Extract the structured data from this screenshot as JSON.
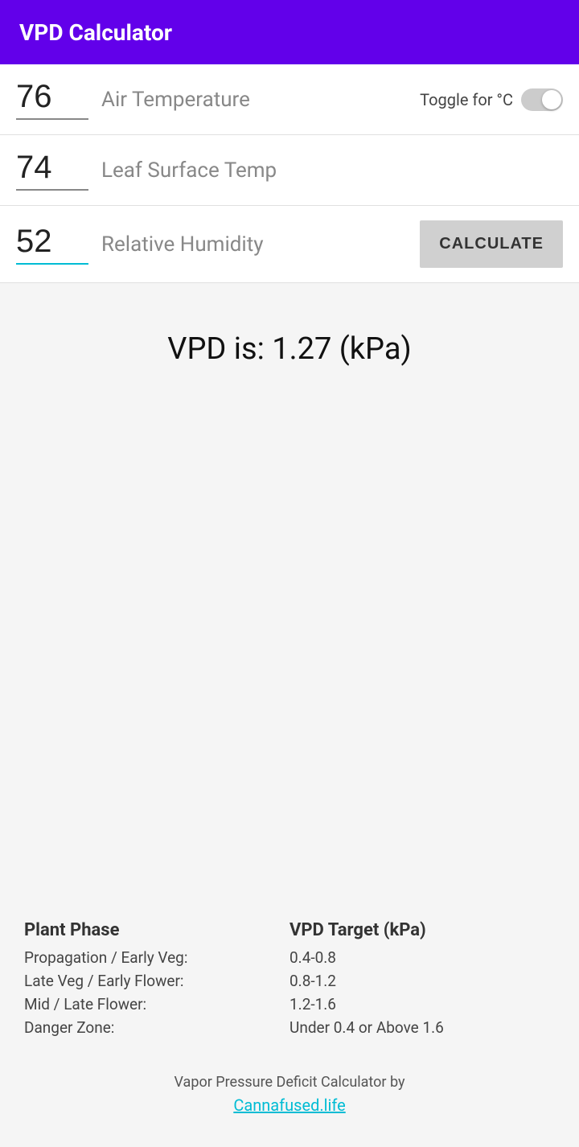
{
  "header": {
    "title": "VPD Calculator"
  },
  "inputs": {
    "air_temp": {
      "value": "76",
      "label": "Air Temperature",
      "id": "air-temp-input"
    },
    "leaf_temp": {
      "value": "74",
      "label": "Leaf Surface Temp",
      "id": "leaf-temp-input"
    },
    "humidity": {
      "value": "52",
      "label": "Relative Humidity",
      "id": "rh-input"
    }
  },
  "toggle": {
    "label": "Toggle for °C"
  },
  "calculate_button": {
    "label": "CALCULATE"
  },
  "result": {
    "text": "VPD is: 1.27 (kPa)"
  },
  "reference": {
    "col1_header": "Plant Phase",
    "col2_header": "VPD Target (kPa)",
    "rows": [
      {
        "phase": "Propagation / Early Veg:",
        "target": "0.4-0.8"
      },
      {
        "phase": "Late Veg / Early Flower:",
        "target": "0.8-1.2"
      },
      {
        "phase": "Mid / Late Flower:",
        "target": "1.2-1.6"
      },
      {
        "phase": "Danger Zone:",
        "target": "Under 0.4 or Above 1.6"
      }
    ]
  },
  "footer": {
    "text": "Vapor Pressure Deficit Calculator by",
    "link": "Cannafused.life"
  }
}
